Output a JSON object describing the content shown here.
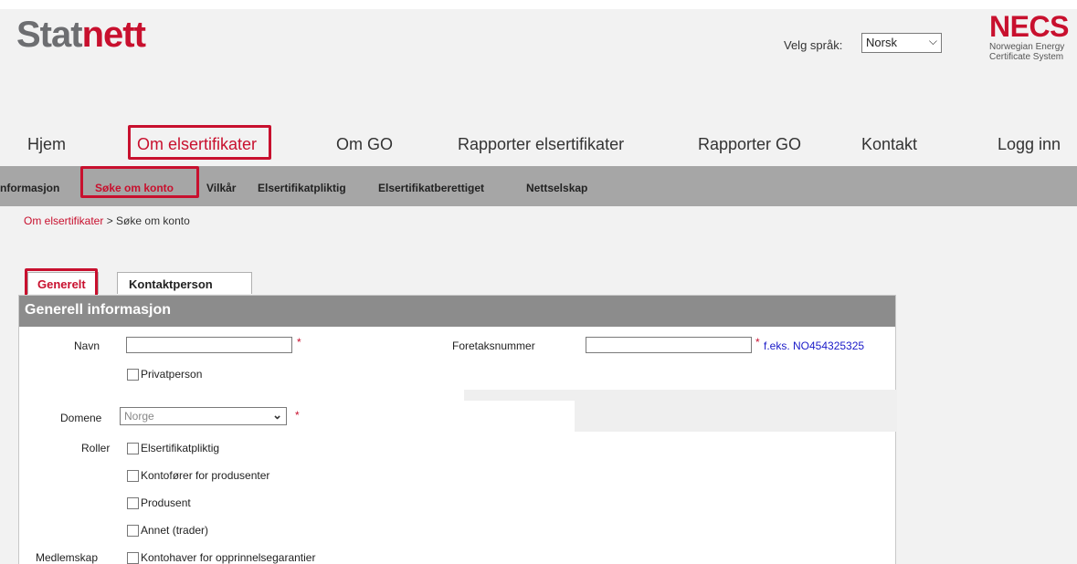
{
  "header": {
    "logo_part1": "Stat",
    "logo_part2": "nett",
    "language_label": "Velg språk:",
    "language_value": "Norsk",
    "necs_title": "NECS",
    "necs_sub1": "Norwegian Energy",
    "necs_sub2": "Certificate System"
  },
  "mainnav": {
    "items": [
      "Hjem",
      "Om elsertifikater",
      "Om GO",
      "Rapporter elsertifikater",
      "Rapporter GO",
      "Kontakt",
      "Logg inn"
    ]
  },
  "subnav": {
    "items": [
      "nformasjon",
      "Søke om konto",
      "Vilkår",
      "Elsertifikatpliktig",
      "Elsertifikatberettiget",
      "Nettselskap"
    ]
  },
  "breadcrumb": {
    "link": "Om elsertifikater",
    "separator": " > ",
    "current": "Søke om konto"
  },
  "tabs": [
    "Generelt",
    "Kontaktperson"
  ],
  "form": {
    "section_title": "Generell informasjon",
    "name_label": "Navn",
    "name_value": "",
    "required_mark": "*",
    "private_label": "Privatperson",
    "org_label": "Foretaksnummer",
    "org_value": "",
    "org_hint": "f.eks. NO454325325",
    "domain_label": "Domene",
    "domain_value": "Norge",
    "roles_label": "Roller",
    "roles": [
      "Elsertifikatpliktig",
      "Kontofører for produsenter",
      "Produsent",
      "Annet (trader)"
    ],
    "membership_label": "Medlemskap",
    "membership_option": "Kontohaver for opprinnelsegarantier"
  },
  "colors": {
    "brand_red": "#c8102e",
    "logo_grey": "#6d6e71",
    "subnav_bg": "#a6a6a6",
    "panel_head": "#8c8c8c",
    "hint_blue": "#1a1ac8"
  }
}
